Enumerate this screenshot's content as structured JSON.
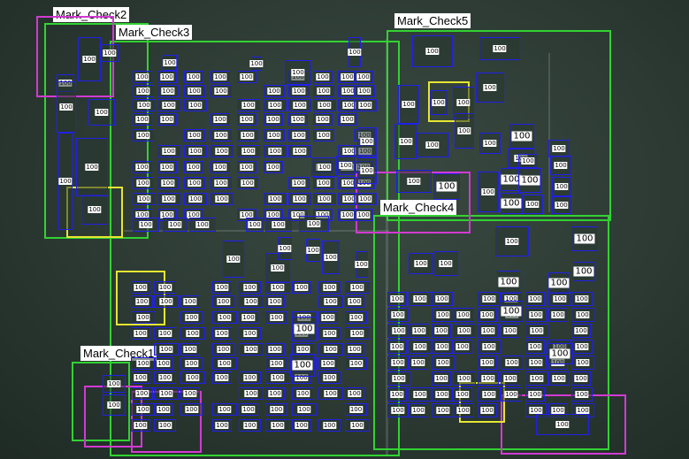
{
  "regions": [
    {
      "label": "Mark_Check2"
    },
    {
      "label": "Mark_Check3"
    },
    {
      "label": "Mark_Check5"
    },
    {
      "label": "Mark_Check4"
    },
    {
      "label": "Mark_Check1"
    }
  ],
  "detection_score": "100",
  "colors": {
    "region_border": "#32d232",
    "detection_border": "#2020e8",
    "highlight_pink": "#d23ad2",
    "highlight_yellow": "#e6e632",
    "background": "#2c3a33"
  }
}
